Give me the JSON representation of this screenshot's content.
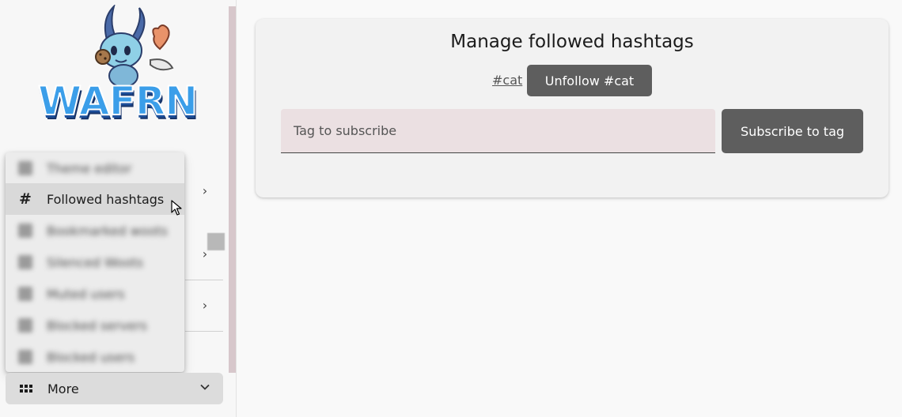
{
  "sidebar": {
    "logo_text": "WAFRN",
    "menu": {
      "items": [
        {
          "label": "Theme editor",
          "icon": "pencil-icon",
          "blurred": true
        },
        {
          "label": "Followed hashtags",
          "icon": "hash-icon",
          "glyph": "#",
          "blurred": false
        },
        {
          "label": "Bookmarked woots",
          "icon": "bookmark-icon",
          "blurred": true
        },
        {
          "label": "Silenced Woots",
          "icon": "mute-icon",
          "blurred": true
        },
        {
          "label": "Muted users",
          "icon": "mute-user-icon",
          "blurred": true
        },
        {
          "label": "Blocked servers",
          "icon": "server-icon",
          "blurred": true
        },
        {
          "label": "Blocked users",
          "icon": "block-user-icon",
          "blurred": true
        }
      ]
    },
    "more": {
      "label": "More",
      "icon": "grid-icon",
      "chevron": "chevron-down-icon"
    }
  },
  "main": {
    "title": "Manage followed hashtags",
    "followed_tags": [
      {
        "tag": "#cat",
        "unfollow_label": "Unfollow #cat"
      }
    ],
    "subscribe": {
      "placeholder": "Tag to subscribe",
      "value": "",
      "button_label": "Subscribe to tag"
    }
  },
  "colors": {
    "button_bg": "#5e5e5e",
    "input_bg": "#ebe0e2",
    "card_bg": "#f2f2f2",
    "page_bg": "#f9f9f9",
    "scrollbar": "#d7c7cb"
  }
}
